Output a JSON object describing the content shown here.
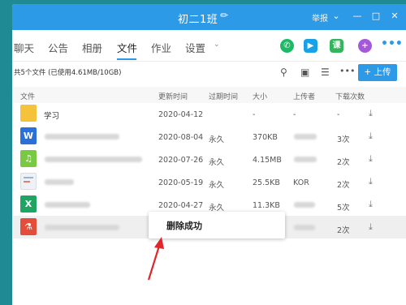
{
  "window": {
    "title": "初二1班",
    "report_label": "举报"
  },
  "tabs": [
    {
      "label": "聊天"
    },
    {
      "label": "公告"
    },
    {
      "label": "相册"
    },
    {
      "label": "文件"
    },
    {
      "label": "作业"
    },
    {
      "label": "设置"
    }
  ],
  "active_tab": "文件",
  "toolbar": {
    "quota_text": "共5个文件 (已使用4.61MB/10GB)",
    "upload_label": "+ 上传"
  },
  "table": {
    "headers": {
      "name": "文件",
      "updated": "更新时间",
      "expiry": "过期时间",
      "size": "大小",
      "uploader": "上传者",
      "downloads": "下载次数"
    },
    "rows": [
      {
        "name": "学习",
        "updated": "2020-04-12",
        "expiry": "",
        "size": "-",
        "uploader": "-",
        "downloads": "-",
        "icon": "folder-icon"
      },
      {
        "name": "",
        "updated": "2020-08-04",
        "expiry": "永久",
        "size": "370KB",
        "uploader": "",
        "downloads": "3次",
        "icon": "word-file-icon"
      },
      {
        "name": "",
        "updated": "2020-07-26",
        "expiry": "永久",
        "size": "4.15MB",
        "uploader": "",
        "downloads": "2次",
        "icon": "audio-file-icon"
      },
      {
        "name": "",
        "updated": "2020-05-19",
        "expiry": "永久",
        "size": "25.5KB",
        "uploader": "KOR",
        "downloads": "2次",
        "icon": "image-file-icon"
      },
      {
        "name": "",
        "updated": "2020-04-27",
        "expiry": "永久",
        "size": "11.3KB",
        "uploader": "",
        "downloads": "5次",
        "icon": "excel-file-icon"
      },
      {
        "name": "",
        "updated": "",
        "expiry": "",
        "size": "",
        "uploader": "",
        "downloads": "2次",
        "icon": "pdf-file-icon"
      }
    ]
  },
  "toast": {
    "text": "删除成功"
  },
  "colors": {
    "accent": "#2d9ae8",
    "desktop": "#1f8a93",
    "phone": "#1db965",
    "video": "#1aa0e6",
    "classroom": "#34b45c",
    "plus": "#a45ad6",
    "word": "#2b6fd9",
    "audio": "#7ac943",
    "excel": "#1fa463",
    "pdf": "#e44d3a",
    "arrow": "#e0262b"
  }
}
